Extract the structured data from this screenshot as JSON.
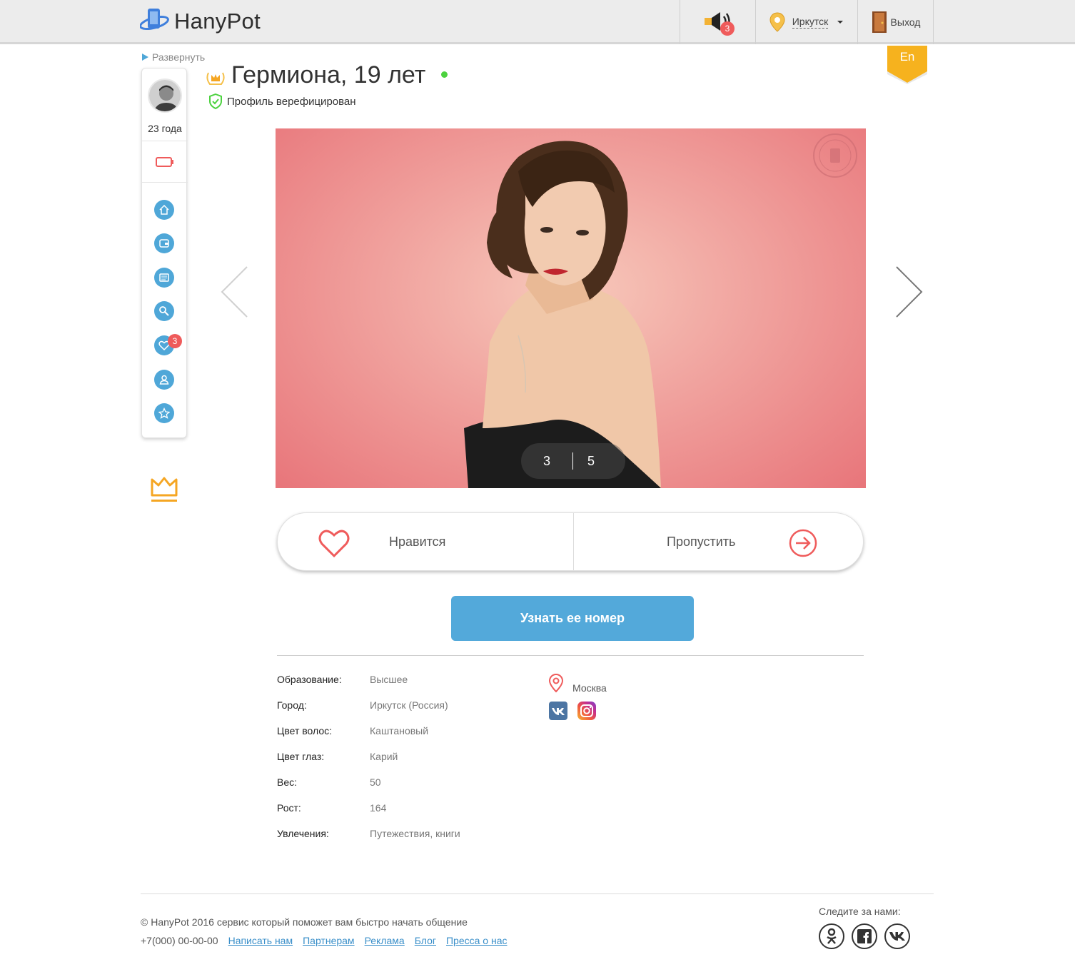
{
  "brand": {
    "name": "HanyPot"
  },
  "header": {
    "notifications_count": "3",
    "city": "Иркутск",
    "exit_label": "Выход",
    "lang": "En"
  },
  "sidebar": {
    "expand_label": "Развернуть",
    "user_age": "23 года",
    "likes_badge": "3"
  },
  "profile": {
    "name_age": "Гермиона, 19 лет",
    "verified_label": "Профиль верефицирован",
    "photo_current": "3",
    "photo_total": "5"
  },
  "actions": {
    "like_label": "Нравится",
    "skip_label": "Пропустить",
    "cta_label": "Узнать ее номер"
  },
  "info": [
    {
      "label": "Образование:",
      "value": "Высшее"
    },
    {
      "label": "Город:",
      "value": "Иркутск (Россия)"
    },
    {
      "label": "Цвет волос:",
      "value": "Каштановый"
    },
    {
      "label": "Цвет глаз:",
      "value": "Карий"
    },
    {
      "label": "Вес:",
      "value": "50"
    },
    {
      "label": "Рост:",
      "value": "164"
    },
    {
      "label": "Увлечения:",
      "value": "Путежествия, книги"
    }
  ],
  "location": {
    "city": "Москва"
  },
  "footer": {
    "copyright": "© HanyPot 2016 сервис который поможет вам быстро начать общение",
    "phone": "+7(000) 00-00-00",
    "links": [
      "Написать нам",
      "Партнерам",
      "Реклама",
      "Блог",
      "Пресса о нас"
    ],
    "follow_label": "Следите за нами:"
  },
  "colors": {
    "accent_blue": "#53a9da",
    "badge_red": "#ef5b5b",
    "online_green": "#4cd23f",
    "crown_gold": "#f5a623"
  }
}
